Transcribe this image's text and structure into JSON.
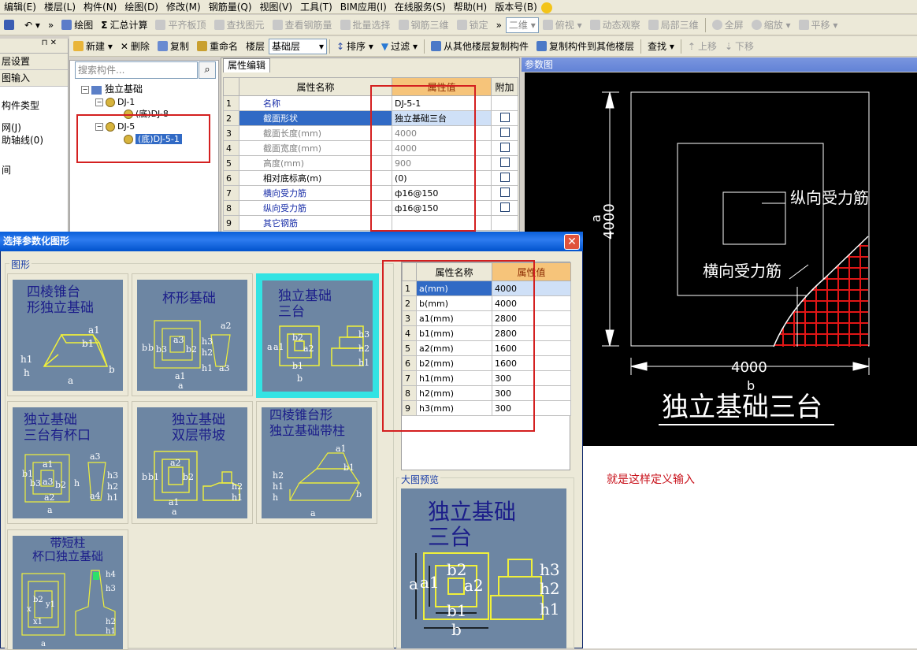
{
  "menubar": [
    "编辑(E)",
    "楼层(L)",
    "构件(N)",
    "绘图(D)",
    "修改(M)",
    "钢筋量(Q)",
    "视图(V)",
    "工具(T)",
    "BIM应用(I)",
    "在线服务(S)",
    "帮助(H)",
    "版本号(B)"
  ],
  "toolbar1": {
    "draw": "绘图",
    "sum": "汇总计算",
    "flush_slab": "平齐板顶",
    "find_element": "查找图元",
    "view_rebar": "查看钢筋量",
    "batch_select": "批量选择",
    "rebar_3d": "钢筋三维",
    "lock": "锁定",
    "view_mode": "二维",
    "top_view": "俯视",
    "dynamic": "动态观察",
    "local_3d": "局部三维",
    "fullscreen": "全屏",
    "zoom": "缩放",
    "pan": "平移"
  },
  "toolbar2": {
    "new": "新建",
    "delete": "删除",
    "copy": "复制",
    "rename": "重命名",
    "floor_label": "楼层",
    "floor_value": "基础层",
    "sort": "排序",
    "filter": "过滤",
    "copy_from": "从其他楼层复制构件",
    "copy_to": "复制构件到其他楼层",
    "find": "查找",
    "move_up": "上移",
    "move_down": "下移"
  },
  "leftnav": {
    "items": [
      "层设置",
      "图输入",
      "构件类型",
      "网(J)",
      "助轴线(0)",
      "间"
    ]
  },
  "tree": {
    "search_placeholder": "搜索构件...",
    "root": "独立基础",
    "nodes": [
      {
        "label": "DJ-1",
        "level": 1
      },
      {
        "label": "(底)DJ-8",
        "level": 2
      },
      {
        "label": "DJ-5",
        "level": 1
      },
      {
        "label": "(底)DJ-5-1",
        "level": 2
      }
    ]
  },
  "props": {
    "tab": "属性编辑",
    "headers": {
      "name": "属性名称",
      "value": "属性值",
      "extra": "附加"
    },
    "rows": [
      {
        "n": "1",
        "name": "名称",
        "value": "DJ-5-1",
        "chk": false,
        "style": "blue"
      },
      {
        "n": "2",
        "name": "截面形状",
        "value": "独立基础三台",
        "chk": true,
        "style": "sel"
      },
      {
        "n": "3",
        "name": "截面长度(mm)",
        "value": "4000",
        "chk": true,
        "style": "gray"
      },
      {
        "n": "4",
        "name": "截面宽度(mm)",
        "value": "4000",
        "chk": true,
        "style": "gray"
      },
      {
        "n": "5",
        "name": "高度(mm)",
        "value": "900",
        "chk": true,
        "style": "gray"
      },
      {
        "n": "6",
        "name": "相对底标高(m)",
        "value": "(0)",
        "chk": true,
        "style": ""
      },
      {
        "n": "7",
        "name": "横向受力筋",
        "value": "ф16@150",
        "chk": true,
        "style": "blue"
      },
      {
        "n": "8",
        "name": "纵向受力筋",
        "value": "ф16@150",
        "chk": true,
        "style": "blue"
      },
      {
        "n": "9",
        "name": "其它钢筋",
        "value": "",
        "chk": false,
        "style": "blue"
      }
    ]
  },
  "dialog": {
    "title": "选择参数化图形",
    "group_shape": "图形",
    "shapes": [
      {
        "title": "四棱锥台\n形独立基础"
      },
      {
        "title": "杯形基础"
      },
      {
        "title": "独立基础\n三台"
      },
      {
        "title": "独立基础\n三台有杯口"
      },
      {
        "title": "独立基础\n双层带坡"
      },
      {
        "title": "四棱锥台形\n独立基础带柱"
      },
      {
        "title": "带短柱\n杯口独立基础"
      }
    ],
    "param_headers": {
      "name": "属性名称",
      "value": "属性值"
    },
    "params": [
      {
        "n": "1",
        "name": "a(mm)",
        "value": "4000"
      },
      {
        "n": "2",
        "name": "b(mm)",
        "value": "4000"
      },
      {
        "n": "3",
        "name": "a1(mm)",
        "value": "2800"
      },
      {
        "n": "4",
        "name": "b1(mm)",
        "value": "2800"
      },
      {
        "n": "5",
        "name": "a2(mm)",
        "value": "1600"
      },
      {
        "n": "6",
        "name": "b2(mm)",
        "value": "1600"
      },
      {
        "n": "7",
        "name": "h1(mm)",
        "value": "300"
      },
      {
        "n": "8",
        "name": "h2(mm)",
        "value": "300"
      },
      {
        "n": "9",
        "name": "h3(mm)",
        "value": "300"
      }
    ],
    "preview_label": "大图预览",
    "preview_title": "独立基础\n三台",
    "dim_labels": {
      "a": "a",
      "a1": "a1",
      "b": "b",
      "b1": "b1",
      "b2": "b2",
      "a2": "a2",
      "h1": "h1",
      "h2": "h2",
      "h3": "h3"
    }
  },
  "param_view": {
    "header": "参数图",
    "long_rebar": "纵向受力筋",
    "trans_rebar": "横向受力筋",
    "dim_left": "4000",
    "dim_left_label": "a",
    "dim_bottom": "4000",
    "dim_bottom_label": "b",
    "title": "独立基础三台"
  },
  "note": "就是这样定义输入",
  "colors": {
    "highlight_red": "#d42020",
    "selected_blue": "#316ac5",
    "value_header": "#f6c47a",
    "thumb_bg": "#6d86a3",
    "selected_thumb": "#33e3e3"
  }
}
